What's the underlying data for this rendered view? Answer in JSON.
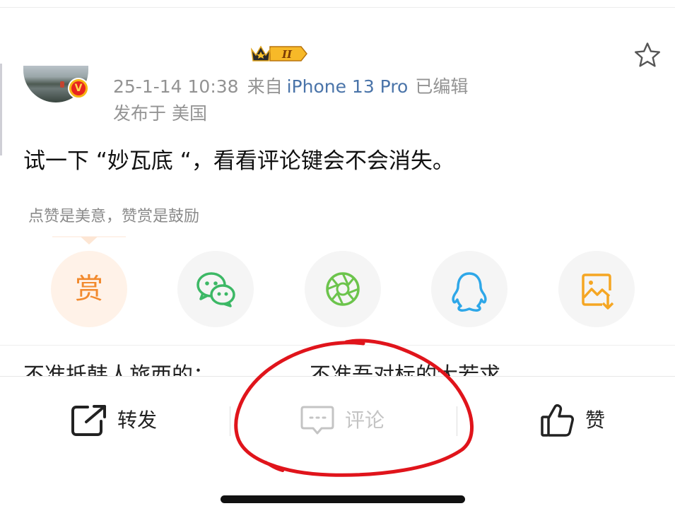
{
  "post": {
    "timestamp": "25-1-14 10:38",
    "source_prefix": "来自",
    "device": "iPhone 13 Pro",
    "edited": "已编辑",
    "location": "发布于 美国",
    "level_badge": "II",
    "vip_mark": "V",
    "text": "试一下 “妙瓦底 “，看看评论键会不会消失。"
  },
  "reward": {
    "hint": "点赞是美意，赞赏是鼓励",
    "reward_glyph": "赏"
  },
  "share_targets": [
    {
      "icon": "reward-icon"
    },
    {
      "icon": "wechat-icon"
    },
    {
      "icon": "wechat-moments-icon"
    },
    {
      "icon": "qq-icon"
    },
    {
      "icon": "save-image-icon"
    }
  ],
  "next_item": {
    "text": "不准抵韩人旅西的：　　　　　不准吾对标的大若求"
  },
  "bottom_bar": {
    "repost_label": "转发",
    "comment_label": "评论",
    "like_label": "赞"
  },
  "colors": {
    "link": "#4a74a9",
    "meta": "#939393",
    "reward_orange": "#f28a2e",
    "wechat_green": "#3cb865",
    "moments_green": "#6cc44c",
    "qq_blue": "#2ea7e8",
    "image_orange": "#f5a623",
    "disabled_gray": "#c4c4c4",
    "annotation_red": "#e0141b"
  }
}
